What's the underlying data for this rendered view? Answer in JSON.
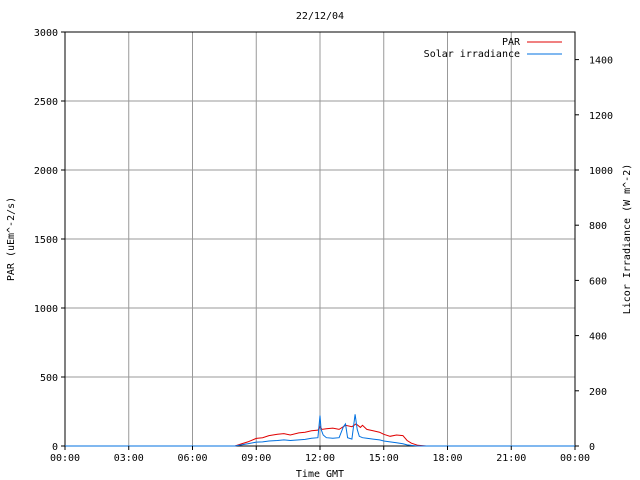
{
  "chart_data": {
    "type": "line",
    "title": "22/12/04",
    "xlabel": "Time GMT",
    "ylabel": "PAR (uEm^-2/s)",
    "y2label": "Licor Irradiance (W m^-2)",
    "x_unit": "hours GMT",
    "xlim": [
      0,
      24
    ],
    "ylim": [
      0,
      3000
    ],
    "y2lim": [
      0,
      1500
    ],
    "grid": true,
    "legend_position": "top-right",
    "x_ticks": [
      {
        "value": 0,
        "label": "00:00"
      },
      {
        "value": 3,
        "label": "03:00"
      },
      {
        "value": 6,
        "label": "06:00"
      },
      {
        "value": 9,
        "label": "09:00"
      },
      {
        "value": 12,
        "label": "12:00"
      },
      {
        "value": 15,
        "label": "15:00"
      },
      {
        "value": 18,
        "label": "18:00"
      },
      {
        "value": 21,
        "label": "21:00"
      },
      {
        "value": 24,
        "label": "00:00"
      }
    ],
    "y_ticks": [
      {
        "value": 0,
        "label": "0"
      },
      {
        "value": 500,
        "label": "500"
      },
      {
        "value": 1000,
        "label": "1000"
      },
      {
        "value": 1500,
        "label": "1500"
      },
      {
        "value": 2000,
        "label": "2000"
      },
      {
        "value": 2500,
        "label": "2500"
      },
      {
        "value": 3000,
        "label": "3000"
      }
    ],
    "y2_ticks": [
      {
        "value": 0,
        "label": "0"
      },
      {
        "value": 200,
        "label": "200"
      },
      {
        "value": 400,
        "label": "400"
      },
      {
        "value": 600,
        "label": "600"
      },
      {
        "value": 800,
        "label": "800"
      },
      {
        "value": 1000,
        "label": "1000"
      },
      {
        "value": 1200,
        "label": "1200"
      },
      {
        "value": 1400,
        "label": "1400"
      }
    ],
    "series": [
      {
        "name": "PAR",
        "axis": "left",
        "color": "#e00000",
        "x": [
          0,
          8.0,
          8.3,
          8.6,
          9.0,
          9.3,
          9.6,
          10.0,
          10.3,
          10.6,
          11.0,
          11.3,
          11.6,
          11.9,
          12.0,
          12.1,
          12.3,
          12.6,
          12.9,
          13.2,
          13.5,
          13.7,
          13.9,
          14.0,
          14.2,
          14.5,
          14.8,
          15.0,
          15.3,
          15.6,
          15.9,
          16.1,
          16.3,
          16.6,
          17.0,
          24
        ],
        "y": [
          0,
          0,
          15,
          30,
          55,
          60,
          75,
          85,
          90,
          80,
          95,
          100,
          110,
          115,
          140,
          120,
          125,
          130,
          120,
          150,
          140,
          160,
          135,
          150,
          120,
          110,
          100,
          85,
          70,
          80,
          75,
          40,
          20,
          5,
          0,
          0
        ]
      },
      {
        "name": "Solar irradiance",
        "axis": "right",
        "color": "#0070e0",
        "x": [
          0,
          8.0,
          8.3,
          8.6,
          9.0,
          9.3,
          9.6,
          10.0,
          10.3,
          10.6,
          11.0,
          11.3,
          11.6,
          11.9,
          12.0,
          12.05,
          12.15,
          12.3,
          12.6,
          12.9,
          13.1,
          13.2,
          13.3,
          13.5,
          13.65,
          13.75,
          13.85,
          14.0,
          14.2,
          14.5,
          14.8,
          15.0,
          15.3,
          15.6,
          15.9,
          16.1,
          16.3,
          16.6,
          17.0,
          24
        ],
        "y": [
          0,
          0,
          4,
          8,
          14,
          15,
          18,
          20,
          22,
          20,
          22,
          24,
          28,
          30,
          110,
          60,
          40,
          30,
          28,
          30,
          70,
          80,
          30,
          25,
          115,
          60,
          35,
          30,
          28,
          25,
          22,
          18,
          15,
          12,
          8,
          4,
          2,
          0,
          0,
          0
        ]
      }
    ]
  }
}
